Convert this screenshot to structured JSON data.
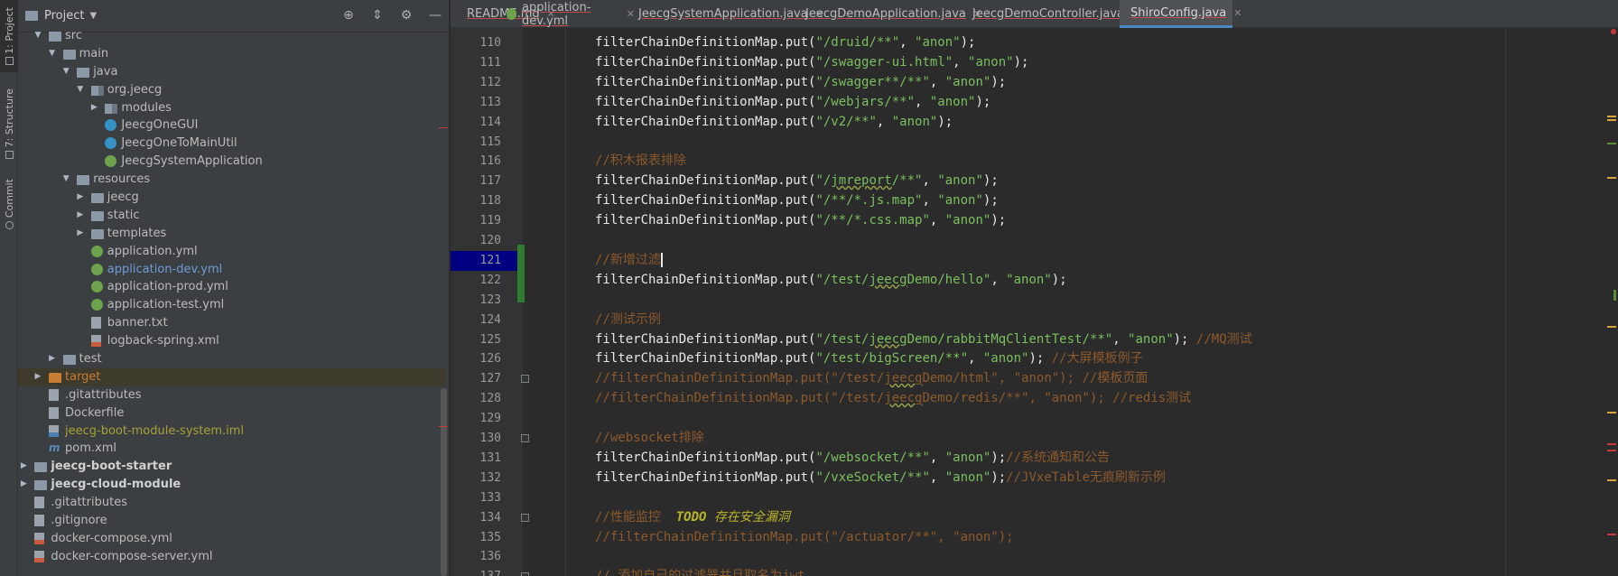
{
  "side_tabs": {
    "project": "1: Project",
    "structure": "7: Structure",
    "commit": "Commit"
  },
  "project_panel": {
    "title": "Project",
    "tree": [
      {
        "label": "src",
        "depth": 0,
        "arrow": "open",
        "icon": "folder-icon"
      },
      {
        "label": "main",
        "depth": 1,
        "arrow": "open",
        "icon": "folder-icon"
      },
      {
        "label": "java",
        "depth": 2,
        "arrow": "open",
        "icon": "folder-icon"
      },
      {
        "label": "org.jeecg",
        "depth": 3,
        "arrow": "open",
        "icon": "package-icon"
      },
      {
        "label": "modules",
        "depth": 4,
        "arrow": "closed",
        "icon": "package-icon"
      },
      {
        "label": "JeecgOneGUI",
        "depth": 4,
        "arrow": "none",
        "icon": "class-icon"
      },
      {
        "label": "JeecgOneToMainUtil",
        "depth": 4,
        "arrow": "none",
        "icon": "class-icon"
      },
      {
        "label": "JeecgSystemApplication",
        "depth": 4,
        "arrow": "none",
        "icon": "spring-class-icon"
      },
      {
        "label": "resources",
        "depth": 2,
        "arrow": "open",
        "icon": "folder-icon"
      },
      {
        "label": "jeecg",
        "depth": 3,
        "arrow": "closed",
        "icon": "folder-icon"
      },
      {
        "label": "static",
        "depth": 3,
        "arrow": "closed",
        "icon": "folder-icon"
      },
      {
        "label": "templates",
        "depth": 3,
        "arrow": "closed",
        "icon": "folder-icon"
      },
      {
        "label": "application.yml",
        "depth": 3,
        "arrow": "none",
        "icon": "spring-yml-icon"
      },
      {
        "label": "application-dev.yml",
        "depth": 3,
        "arrow": "none",
        "icon": "spring-yml-icon",
        "color": "blue"
      },
      {
        "label": "application-prod.yml",
        "depth": 3,
        "arrow": "none",
        "icon": "spring-yml-icon"
      },
      {
        "label": "application-test.yml",
        "depth": 3,
        "arrow": "none",
        "icon": "spring-yml-icon"
      },
      {
        "label": "banner.txt",
        "depth": 3,
        "arrow": "none",
        "icon": "text-file-icon"
      },
      {
        "label": "logback-spring.xml",
        "depth": 3,
        "arrow": "none",
        "icon": "xml-file-icon"
      },
      {
        "label": "test",
        "depth": 1,
        "arrow": "closed",
        "icon": "folder-icon"
      },
      {
        "label": "target",
        "depth": 0,
        "arrow": "closed",
        "icon": "excluded-folder-icon",
        "color": "orange",
        "selected": true
      },
      {
        "label": ".gitattributes",
        "depth": 0,
        "arrow": "none",
        "icon": "text-file-icon"
      },
      {
        "label": "Dockerfile",
        "depth": 0,
        "arrow": "none",
        "icon": "docker-file-icon"
      },
      {
        "label": "jeecg-boot-module-system.iml",
        "depth": 0,
        "arrow": "none",
        "icon": "iml-file-icon",
        "color": "olive"
      },
      {
        "label": "pom.xml",
        "depth": 0,
        "arrow": "none",
        "icon": "maven-icon"
      },
      {
        "label": "jeecg-boot-starter",
        "depth": -1,
        "arrow": "closed",
        "icon": "module-folder-icon",
        "bold": true
      },
      {
        "label": "jeecg-cloud-module",
        "depth": -1,
        "arrow": "closed",
        "icon": "module-folder-icon",
        "bold": true
      },
      {
        "label": ".gitattributes",
        "depth": -1,
        "arrow": "none",
        "icon": "text-file-icon"
      },
      {
        "label": ".gitignore",
        "depth": -1,
        "arrow": "none",
        "icon": "text-file-icon"
      },
      {
        "label": "docker-compose.yml",
        "depth": -1,
        "arrow": "none",
        "icon": "yml-file-icon"
      },
      {
        "label": "docker-compose-server.yml",
        "depth": -1,
        "arrow": "none",
        "icon": "yml-file-icon"
      }
    ]
  },
  "tabs": [
    {
      "label": "README.md",
      "icon": "markdown-icon",
      "active": false
    },
    {
      "label": "application-dev.yml",
      "icon": "spring-yml-icon",
      "active": false
    },
    {
      "label": "JeecgSystemApplication.java",
      "icon": "spring-class-icon",
      "active": false
    },
    {
      "label": "JeecgDemoApplication.java",
      "icon": "java-file-icon",
      "active": false
    },
    {
      "label": "JeecgDemoController.java",
      "icon": "class-icon",
      "active": false
    },
    {
      "label": "ShiroConfig.java",
      "icon": "class-icon",
      "active": true
    }
  ],
  "editor": {
    "current_line": 121,
    "lines": [
      {
        "n": "110",
        "tokens": [
          [
            "id",
            "filterChainDefinitionMap.put("
          ],
          [
            "str2",
            "\"/druid/**\""
          ],
          [
            "id",
            ", "
          ],
          [
            "str2",
            "\"anon\""
          ],
          [
            "id",
            ");"
          ]
        ]
      },
      {
        "n": "111",
        "tokens": [
          [
            "id",
            "filterChainDefinitionMap.put("
          ],
          [
            "str2",
            "\"/swagger-ui.html\""
          ],
          [
            "id",
            ", "
          ],
          [
            "str2",
            "\"anon\""
          ],
          [
            "id",
            ");"
          ]
        ]
      },
      {
        "n": "112",
        "tokens": [
          [
            "id",
            "filterChainDefinitionMap.put("
          ],
          [
            "str2",
            "\"/swagger**/**\""
          ],
          [
            "id",
            ", "
          ],
          [
            "str2",
            "\"anon\""
          ],
          [
            "id",
            ");"
          ]
        ]
      },
      {
        "n": "113",
        "tokens": [
          [
            "id",
            "filterChainDefinitionMap.put("
          ],
          [
            "str2",
            "\"/webjars/**\""
          ],
          [
            "id",
            ", "
          ],
          [
            "str2",
            "\"anon\""
          ],
          [
            "id",
            ");"
          ]
        ]
      },
      {
        "n": "114",
        "tokens": [
          [
            "id",
            "filterChainDefinitionMap.put("
          ],
          [
            "str2",
            "\"/v2/**\""
          ],
          [
            "id",
            ", "
          ],
          [
            "str2",
            "\"anon\""
          ],
          [
            "id",
            ");"
          ]
        ]
      },
      {
        "n": "115",
        "tokens": []
      },
      {
        "n": "116",
        "tokens": [
          [
            "cmt",
            "//积木报表排除"
          ]
        ]
      },
      {
        "n": "117",
        "tokens": [
          [
            "id",
            "filterChainDefinitionMap.put("
          ],
          [
            "str2",
            "\"/"
          ],
          [
            "wavy",
            "jmreport"
          ],
          [
            "str2",
            "/**\""
          ],
          [
            "id",
            ", "
          ],
          [
            "str2",
            "\"anon\""
          ],
          [
            "id",
            ");"
          ]
        ]
      },
      {
        "n": "118",
        "tokens": [
          [
            "id",
            "filterChainDefinitionMap.put("
          ],
          [
            "str2",
            "\"/**/*.js.map\""
          ],
          [
            "id",
            ", "
          ],
          [
            "str2",
            "\"anon\""
          ],
          [
            "id",
            ");"
          ]
        ]
      },
      {
        "n": "119",
        "tokens": [
          [
            "id",
            "filterChainDefinitionMap.put("
          ],
          [
            "str2",
            "\"/**/*.css.map\""
          ],
          [
            "id",
            ", "
          ],
          [
            "str2",
            "\"anon\""
          ],
          [
            "id",
            ");"
          ]
        ]
      },
      {
        "n": "120",
        "tokens": []
      },
      {
        "n": "121",
        "tokens": [
          [
            "cmt",
            "//新增过滤"
          ],
          [
            "caret",
            ""
          ]
        ]
      },
      {
        "n": "122",
        "tokens": [
          [
            "id",
            "filterChainDefinitionMap.put("
          ],
          [
            "str2",
            "\"/test/"
          ],
          [
            "wavy",
            "jeecg"
          ],
          [
            "str2",
            "Demo/hello\""
          ],
          [
            "id",
            ", "
          ],
          [
            "str2",
            "\"anon\""
          ],
          [
            "id",
            ");"
          ]
        ]
      },
      {
        "n": "123",
        "tokens": []
      },
      {
        "n": "124",
        "tokens": [
          [
            "cmt",
            "//测试示例"
          ]
        ]
      },
      {
        "n": "125",
        "tokens": [
          [
            "id",
            "filterChainDefinitionMap.put("
          ],
          [
            "str2",
            "\"/test/"
          ],
          [
            "wavy",
            "jeecg"
          ],
          [
            "str2",
            "Demo/rabbitMqClientTest/**\""
          ],
          [
            "id",
            ", "
          ],
          [
            "str2",
            "\"anon\""
          ],
          [
            "id",
            "); "
          ],
          [
            "cmt",
            "//MQ测试"
          ]
        ]
      },
      {
        "n": "126",
        "tokens": [
          [
            "id",
            "filterChainDefinitionMap.put("
          ],
          [
            "str2",
            "\"/test/bigScreen/**\""
          ],
          [
            "id",
            ", "
          ],
          [
            "str2",
            "\"anon\""
          ],
          [
            "id",
            "); "
          ],
          [
            "cmt",
            "//大屏模板例子"
          ]
        ]
      },
      {
        "n": "127",
        "tokens": [
          [
            "cmt",
            "//filterChainDefinitionMap.put(\"/test/"
          ],
          [
            "wavyc",
            "jeecg"
          ],
          [
            "cmt",
            "Demo/html\", \"anon\"); //模板页面"
          ]
        ]
      },
      {
        "n": "128",
        "tokens": [
          [
            "cmt",
            "//filterChainDefinitionMap.put(\"/test/"
          ],
          [
            "wavyc",
            "jeecg"
          ],
          [
            "cmt",
            "Demo/redis/**\", \"anon\"); //redis测试"
          ]
        ]
      },
      {
        "n": "129",
        "tokens": []
      },
      {
        "n": "130",
        "tokens": [
          [
            "cmt",
            "//websocket排除"
          ]
        ]
      },
      {
        "n": "131",
        "tokens": [
          [
            "id",
            "filterChainDefinitionMap.put("
          ],
          [
            "str2",
            "\"/websocket/**\""
          ],
          [
            "id",
            ", "
          ],
          [
            "str2",
            "\"anon\""
          ],
          [
            "id",
            ");"
          ],
          [
            "cmt",
            "//系统通知和公告"
          ]
        ]
      },
      {
        "n": "132",
        "tokens": [
          [
            "id",
            "filterChainDefinitionMap.put("
          ],
          [
            "str2",
            "\"/vxeSocket/**\""
          ],
          [
            "id",
            ", "
          ],
          [
            "str2",
            "\"anon\""
          ],
          [
            "id",
            ");"
          ],
          [
            "cmt",
            "//JVxeTable无痕刷新示例"
          ]
        ]
      },
      {
        "n": "133",
        "tokens": []
      },
      {
        "n": "134",
        "tokens": [
          [
            "cmt",
            "//性能监控  "
          ],
          [
            "todo",
            "TODO"
          ],
          [
            "todoc",
            " 存在安全漏洞"
          ]
        ]
      },
      {
        "n": "135",
        "tokens": [
          [
            "cmt",
            "//filterChainDefinitionMap.put(\"/actuator/**\", \"anon\");"
          ]
        ]
      },
      {
        "n": "136",
        "tokens": []
      },
      {
        "n": "137",
        "tokens": [
          [
            "cmt",
            "// 添加自己的过滤器并且取名为jwt"
          ]
        ]
      }
    ]
  },
  "colors": {
    "background": "#2b2b2b",
    "panel": "#3c3f41",
    "current_line": "#000080",
    "string": "#7bbf5f",
    "comment": "#8c5a2c",
    "accent": "#4a88c7"
  }
}
